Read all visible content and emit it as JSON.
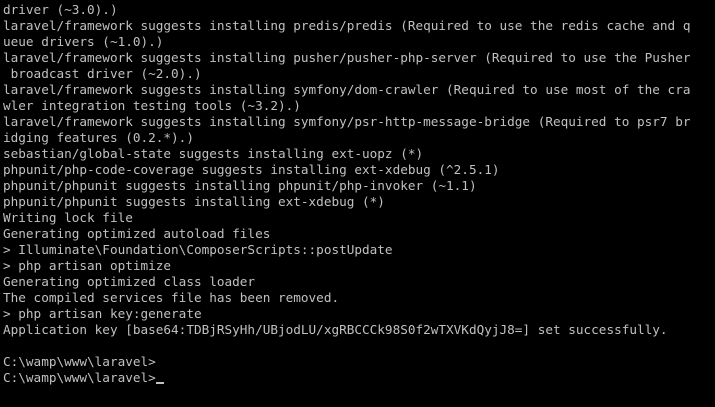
{
  "terminal": {
    "lines": [
      "driver (~3.0).)",
      "laravel/framework suggests installing predis/predis (Required to use the redis cache and q",
      "ueue drivers (~1.0).)",
      "laravel/framework suggests installing pusher/pusher-php-server (Required to use the Pusher",
      " broadcast driver (~2.0).)",
      "laravel/framework suggests installing symfony/dom-crawler (Required to use most of the cra",
      "wler integration testing tools (~3.2).)",
      "laravel/framework suggests installing symfony/psr-http-message-bridge (Required to psr7 br",
      "idging features (0.2.*).)",
      "sebastian/global-state suggests installing ext-uopz (*)",
      "phpunit/php-code-coverage suggests installing ext-xdebug (^2.5.1)",
      "phpunit/phpunit suggests installing phpunit/php-invoker (~1.1)",
      "phpunit/phpunit suggests installing ext-xdebug (*)",
      "Writing lock file",
      "Generating optimized autoload files",
      "> Illuminate\\Foundation\\ComposerScripts::postUpdate",
      "> php artisan optimize",
      "Generating optimized class loader",
      "The compiled services file has been removed.",
      "> php artisan key:generate",
      "Application key [base64:TDBjRSyHh/UBjodLU/xgRBCCCk98S0f2wTXVKdQyjJ8=] set successfully.",
      "",
      "C:\\wamp\\www\\laravel>"
    ],
    "prompt": "C:\\wamp\\www\\laravel>"
  }
}
